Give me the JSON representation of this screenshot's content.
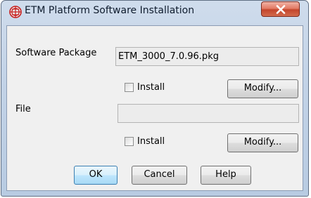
{
  "window": {
    "title": "ETM Platform Software Installation"
  },
  "software_package": {
    "label": "Software Package",
    "value": "ETM_3000_7.0.96.pkg",
    "install_label": "Install",
    "install_checked": false,
    "modify_label": "Modify..."
  },
  "file": {
    "label": "File",
    "value": "",
    "install_label": "Install",
    "install_checked": false,
    "modify_label": "Modify..."
  },
  "buttons": {
    "ok": "OK",
    "cancel": "Cancel",
    "help": "Help"
  },
  "colors": {
    "accent": "#c3452c",
    "focus": "#3c7fb1"
  }
}
